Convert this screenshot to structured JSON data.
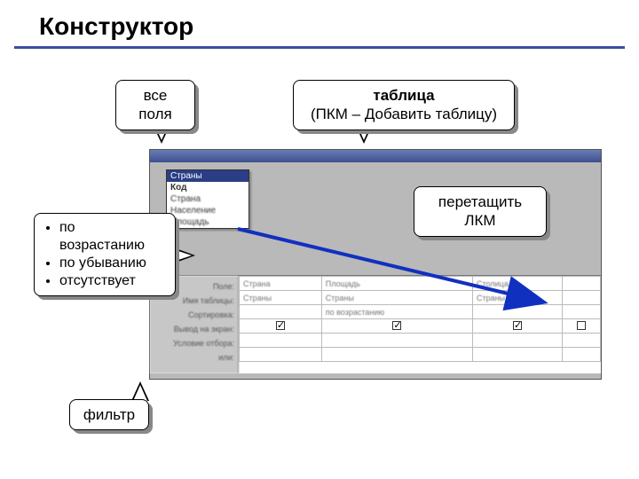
{
  "title": "Конструктор",
  "callouts": {
    "fields": {
      "line1": "все",
      "line2": "поля"
    },
    "table": {
      "line1": "таблица",
      "line2": "(ПКМ – Добавить таблицу)"
    },
    "drag": {
      "line1": "перетащить",
      "line2": "ЛКМ"
    },
    "sort": {
      "items": [
        "по возрастанию",
        "по убыванию",
        "отсутствует"
      ]
    },
    "filter": "фильтр"
  },
  "tablecard": {
    "title": "Страны",
    "key": "Код",
    "rows": [
      "Страна",
      "Население",
      "Площадь"
    ]
  },
  "grid": {
    "rowlabels": [
      "Поле:",
      "Имя таблицы:",
      "Сортировка:",
      "Вывод на экран:",
      "Условие отбора:",
      "или:"
    ],
    "cols": [
      {
        "field": "Страна",
        "table": "Страны",
        "sort": "",
        "show": true
      },
      {
        "field": "Площадь",
        "table": "Страны",
        "sort": "по возрастанию",
        "show": true
      },
      {
        "field": "Столица",
        "table": "Страны",
        "sort": "",
        "show": true
      },
      {
        "field": "",
        "table": "",
        "sort": "",
        "show": false
      }
    ]
  }
}
